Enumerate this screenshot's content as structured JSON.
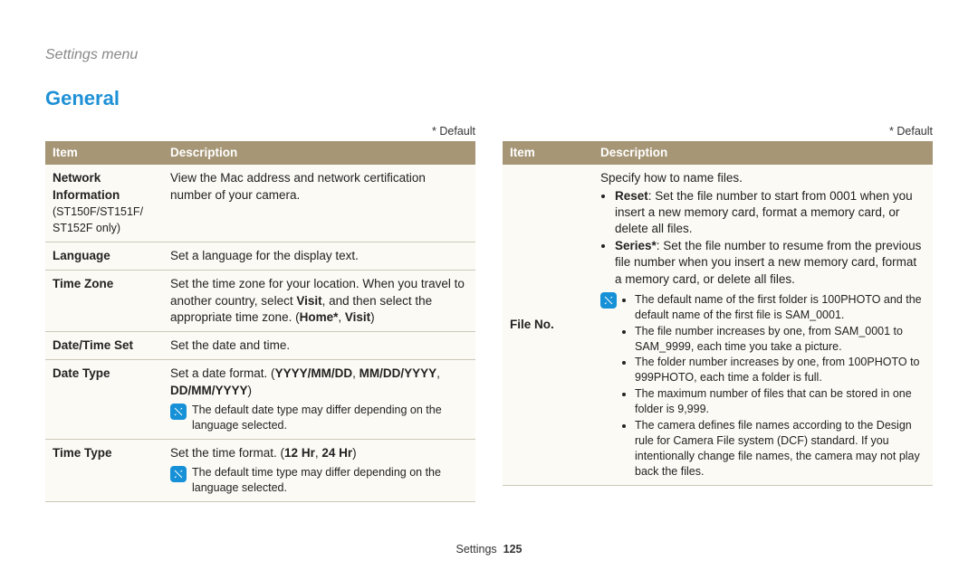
{
  "breadcrumb": "Settings menu",
  "section_title": "General",
  "default_note": "* Default",
  "col1": {
    "header_item": "Item",
    "header_desc": "Description",
    "rows": {
      "network_info_label": "Network Information",
      "network_info_sub": "(ST150F/ST151F/ ST152F only)",
      "network_info_desc": "View the Mac address and network certification number of your camera.",
      "language_label": "Language",
      "language_desc": "Set a language for the display text.",
      "tz_label": "Time Zone",
      "tz_desc_a": "Set the time zone for your location. When you travel to another country, select ",
      "tz_desc_b": "Visit",
      "tz_desc_c": ", and then select the appropriate time zone. (",
      "tz_desc_d": "Home*",
      "tz_desc_e": ", ",
      "tz_desc_f": "Visit",
      "tz_desc_g": ")",
      "dts_label": "Date/Time Set",
      "dts_desc": "Set the date and time.",
      "dtype_label": "Date Type",
      "dtype_line1_a": "Set a date format. (",
      "dtype_line1_b": "YYYY/MM/DD",
      "dtype_line1_c": ", ",
      "dtype_line1_d": "MM/DD/YYYY",
      "dtype_line1_e": ", ",
      "dtype_line1_f": "DD/MM/YYYY",
      "dtype_line1_g": ")",
      "dtype_note": "The default date type may differ depending on the language selected.",
      "ttype_label": "Time Type",
      "ttype_line1_a": "Set the time format. (",
      "ttype_line1_b": "12 Hr",
      "ttype_line1_c": ", ",
      "ttype_line1_d": "24 Hr",
      "ttype_line1_e": ")",
      "ttype_note": "The default time type may differ depending on the language selected."
    }
  },
  "col2": {
    "header_item": "Item",
    "header_desc": "Description",
    "fileno_label": "File No.",
    "fileno_intro": "Specify how to name files.",
    "fileno_reset_label": "Reset",
    "fileno_reset_text": ": Set the file number to start from 0001 when you insert a new memory card, format a memory card, or delete all files.",
    "fileno_series_label": "Series*",
    "fileno_series_text": ": Set the file number to resume from the previous file number when you insert a new memory card, format a memory card, or delete all files.",
    "fileno_note1": "The default name of the first folder is 100PHOTO and the default name of the first file is SAM_0001.",
    "fileno_note2": "The file number increases by one, from SAM_0001 to SAM_9999, each time you take a picture.",
    "fileno_note3": "The folder number increases by one, from 100PHOTO to 999PHOTO, each time a folder is full.",
    "fileno_note4": "The maximum number of files that can be stored in one folder is 9,999.",
    "fileno_note5": "The camera defines file names according to the Design rule for Camera File system (DCF) standard. If you intentionally change file names, the camera may not play back the files."
  },
  "footer_label": "Settings",
  "footer_page": "125"
}
